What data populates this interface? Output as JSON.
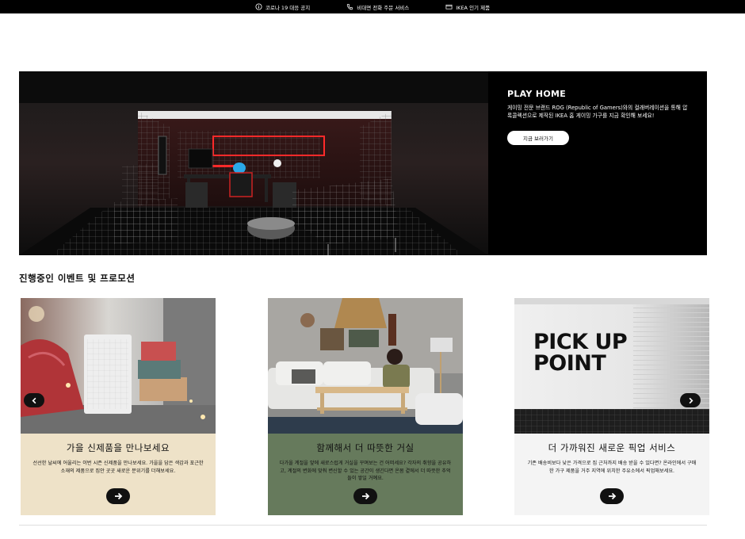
{
  "topbar": {
    "items": [
      {
        "label": "코로나 19 대응 공지",
        "icon": "info-circle-icon"
      },
      {
        "label": "비대면 전화 주문 서비스",
        "icon": "phone-icon"
      },
      {
        "label": "IKEA 인기 제품",
        "icon": "box-icon"
      }
    ]
  },
  "hero": {
    "title": "PLAY HOME",
    "description": "게이밍 전문 브랜드 ROG (Republic of Gamers)와의 컬래버레이션을 통해 압록콜렉션으로 제작된 IKEA 홈 게이밍 가구를 지금 확인해 보세요!",
    "button_label": "지금 보러가기"
  },
  "section": {
    "title": "진행중인 이벤트 및 프로모션"
  },
  "cards": [
    {
      "title": "가을 신제품을 만나보세요",
      "description": "선선한 날씨에 어울리는 이번 시즌 신제품을 만나보세요. 가을을 담은 색감과 포근한 소재의 제품으로 집안 곳곳 새로운 분위기를 더해보세요."
    },
    {
      "title": "함께해서 더 따뜻한 거실",
      "description": "다가올 계절을 앞에 새로스럽게 거실을 꾸며보는 건 어떠세요? 각자의 취향을 공유하고, 계절의 변화에 맞춰 변신할 수 있는 공간이 생긴다면 온몸 곁에서 더 따뜻한 추억들이 쌓일 거예요."
    },
    {
      "title": "더 가까워진 새로운 픽업 서비스",
      "description": "기존 배송비보다 낮은 가격으로 집 근처까지 배송 받을 수 있다면? 온라인에서 구매한 가구 제품을 거주 지역에 위치한 주유소에서 픽업해보세요.",
      "image_text_line1": "PICK UP",
      "image_text_line2": "POINT"
    }
  ],
  "colors": {
    "card1_bg": "#eee2c8",
    "card2_bg": "#667a5c",
    "card3_bg": "#f4f4f4",
    "topbar_bg": "#000000"
  }
}
